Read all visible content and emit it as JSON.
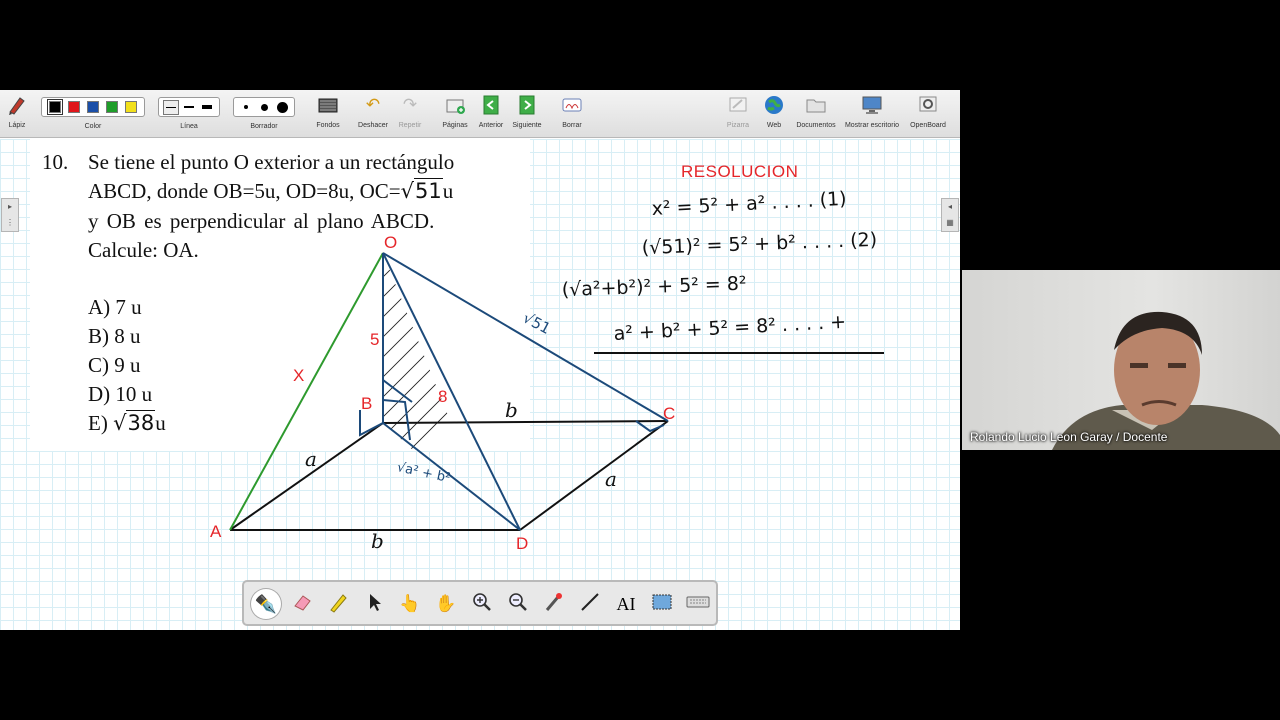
{
  "toolbar": {
    "pen_label": "Lápiz",
    "color_label": "Color",
    "colors": [
      "#000000",
      "#e0161b",
      "#1b4fa8",
      "#1f9d2a",
      "#f2e01c"
    ],
    "line_label": "Línea",
    "eraser_label": "Borrador",
    "backgrounds_label": "Fondos",
    "undo_label": "Deshacer",
    "redo_label": "Repetir",
    "pages_label": "Páginas",
    "previous_label": "Anterior",
    "next_label": "Siguiente",
    "clear_label": "Borrar",
    "board_label": "Pizarra",
    "web_label": "Web",
    "documents_label": "Documentos",
    "desktop_label": "Mostrar escritorio",
    "openboard_label": "OpenBoard"
  },
  "problem": {
    "number": "10.",
    "line1": "Se tiene el punto O exterior a un rectángulo",
    "line2_pre": "ABCD, donde OB=5u, OD=8u, OC=",
    "line2_rad": "51",
    "line2_post": "u",
    "line3": "y OB es perpendicular al plano ABCD.",
    "line4": "Calcule: OA.",
    "options": [
      {
        "text": "A) 7 u"
      },
      {
        "text": "B) 8 u"
      },
      {
        "text": "C) 9 u"
      },
      {
        "text": "D) 10 u"
      }
    ],
    "option_e_pre": "E) ",
    "option_e_rad": "38",
    "option_e_post": "u"
  },
  "figure": {
    "vertices": {
      "O": "O",
      "A": "A",
      "B": "B",
      "C": "C",
      "D": "D"
    },
    "label_x": "X",
    "label_ob": "5",
    "label_od": "8",
    "label_oc": "√51",
    "label_a_left": "a",
    "label_a_right": "a",
    "label_b_top": "b",
    "label_b_bottom": "b",
    "label_bd": "√a² + b²"
  },
  "resolution": {
    "title": "RESOLUCION",
    "eq1": "x² = 5² + a² . . . . (1)",
    "eq2": "(√51)² = 5² + b² . . . . (2)",
    "eq3": "(√a²+b²)² + 5² = 8²",
    "eq4": "a² + b² + 5² = 8² . . . . +"
  },
  "bottom_tools": [
    "pen-tool",
    "eraser-tool",
    "highlighter-tool",
    "select-tool",
    "pointer-tool",
    "hand-tool",
    "zoom-in-tool",
    "zoom-out-tool",
    "laser-tool",
    "line-tool",
    "text-tool",
    "capture-tool",
    "keyboard-tool"
  ],
  "webcam": {
    "caption": "Rolando Lucio Leon Garay / Docente"
  }
}
